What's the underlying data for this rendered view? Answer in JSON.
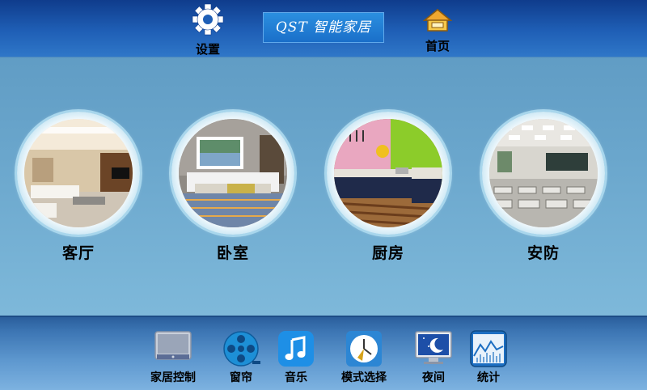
{
  "header": {
    "settings_label": "设置",
    "brand_text": "QST 智能家居",
    "home_label": "首页"
  },
  "rooms": [
    {
      "label": "客厅",
      "icon": "living-room-photo"
    },
    {
      "label": "卧室",
      "icon": "bedroom-photo"
    },
    {
      "label": "厨房",
      "icon": "kitchen-photo"
    },
    {
      "label": "安防",
      "icon": "security-classroom-photo"
    }
  ],
  "dock": [
    {
      "label": "家居控制",
      "icon": "monitor-icon"
    },
    {
      "label": "窗帘",
      "icon": "film-reel-icon"
    },
    {
      "label": "音乐",
      "icon": "music-note-icon"
    },
    {
      "label": "模式选择",
      "icon": "clock-icon"
    },
    {
      "label": "夜间",
      "icon": "night-moon-icon"
    },
    {
      "label": "统计",
      "icon": "chart-icon"
    }
  ],
  "colors": {
    "topbar": "#1f5fb6",
    "background": "#6aa6cc",
    "bottombar": "#4f8ac4",
    "brand": "#1a6fc9"
  }
}
